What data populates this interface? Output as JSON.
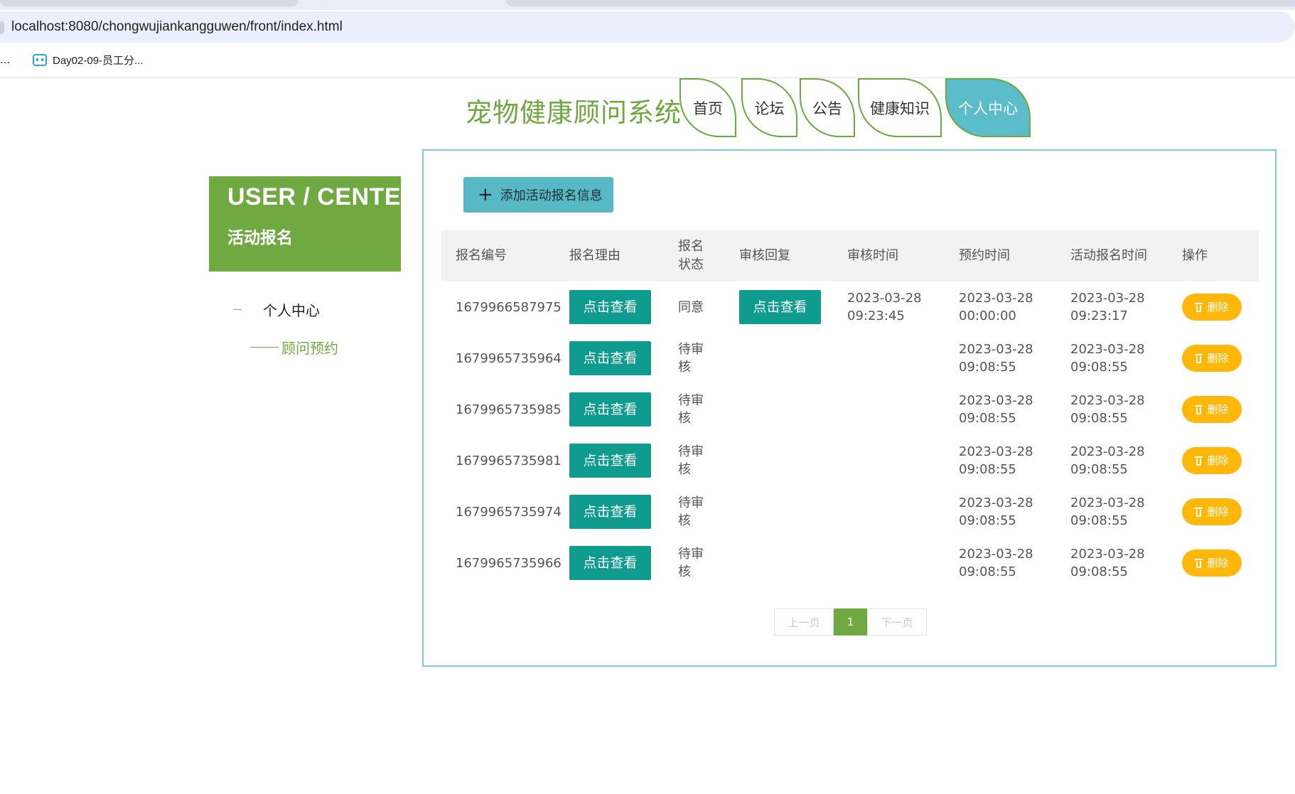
{
  "browser": {
    "url": "localhost:8080/chongwujiankangguwen/front/index.html",
    "bookmarks_more": "...",
    "bookmark": "Day02-09-员工分..."
  },
  "header": {
    "title": "宠物健康顾问系统",
    "nav": [
      "首页",
      "论坛",
      "公告",
      "健康知识",
      "个人中心"
    ],
    "active_nav": "个人中心"
  },
  "sidebar": {
    "card_title": "USER / CENTER",
    "card_subtitle": "活动报名",
    "item": "个人中心",
    "sub_item": "顾问预约"
  },
  "main": {
    "add_button": "添加活动报名信息",
    "columns": [
      "报名编号",
      "报名理由",
      "报名\n状态",
      "审核回复",
      "审核时间",
      "预约时间",
      "活动报名时间",
      "操作"
    ],
    "view_label": "点击查看",
    "delete_label": "删除",
    "rows": [
      {
        "id": "1679966587975",
        "status": "同意",
        "reply": true,
        "review_time": "2023-03-28\n09:23:45",
        "appoint_time": "2023-03-28\n00:00:00",
        "signup_time": "2023-03-28\n09:23:17"
      },
      {
        "id": "1679965735964",
        "status": "待审\n核",
        "reply": false,
        "review_time": "",
        "appoint_time": "2023-03-28\n09:08:55",
        "signup_time": "2023-03-28\n09:08:55"
      },
      {
        "id": "1679965735985",
        "status": "待审\n核",
        "reply": false,
        "review_time": "",
        "appoint_time": "2023-03-28\n09:08:55",
        "signup_time": "2023-03-28\n09:08:55"
      },
      {
        "id": "1679965735981",
        "status": "待审\n核",
        "reply": false,
        "review_time": "",
        "appoint_time": "2023-03-28\n09:08:55",
        "signup_time": "2023-03-28\n09:08:55"
      },
      {
        "id": "1679965735974",
        "status": "待审\n核",
        "reply": false,
        "review_time": "",
        "appoint_time": "2023-03-28\n09:08:55",
        "signup_time": "2023-03-28\n09:08:55"
      },
      {
        "id": "1679965735966",
        "status": "待审\n核",
        "reply": false,
        "review_time": "",
        "appoint_time": "2023-03-28\n09:08:55",
        "signup_time": "2023-03-28\n09:08:55"
      }
    ],
    "pagination": {
      "prev": "上一页",
      "current": "1",
      "next": "下一页"
    }
  },
  "colors": {
    "brand_green": "#70a841",
    "active_tab": "#5bbdc9",
    "view_button": "#0f9b8e",
    "delete_button": "#ffb80a"
  }
}
